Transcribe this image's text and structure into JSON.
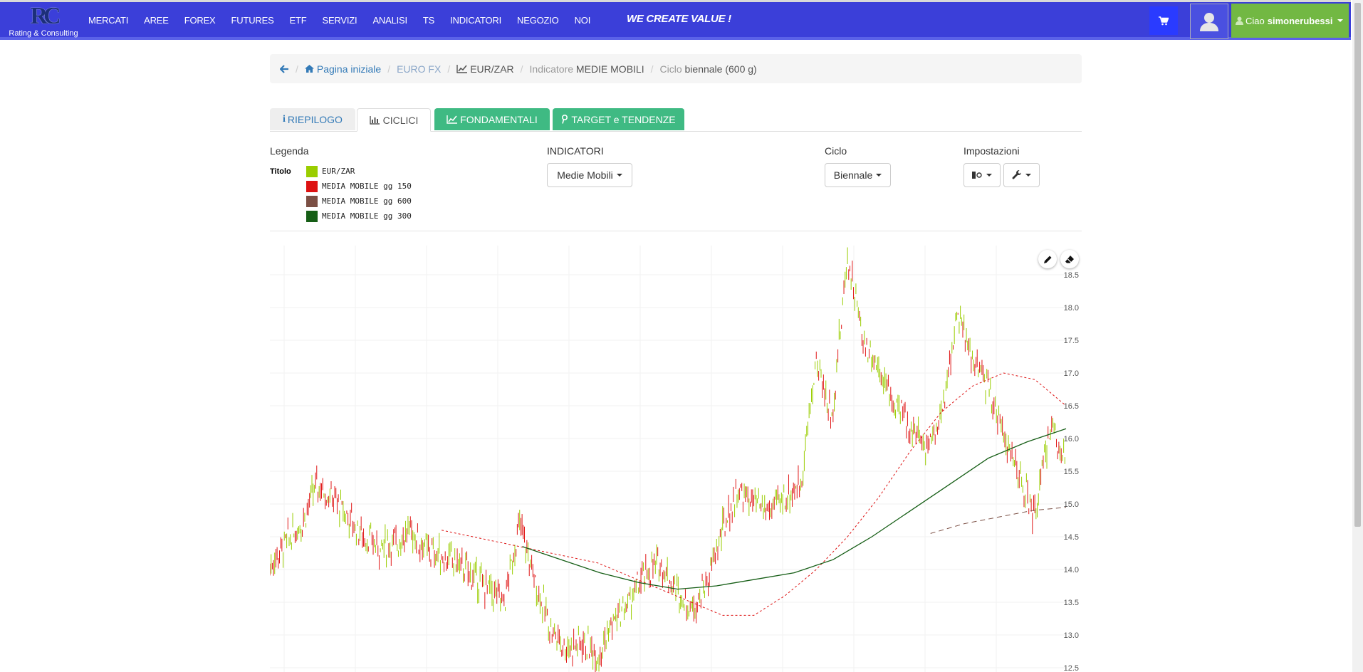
{
  "header": {
    "logo_caption": "Rating & Consulting",
    "nav": [
      "MERCATI",
      "AREE",
      "FOREX",
      "FUTURES",
      "ETF",
      "SERVIZI",
      "ANALISI",
      "TS",
      "INDICATORI",
      "NEGOZIO",
      "NOI"
    ],
    "slogan": "WE CREATE VALUE !",
    "greeting": "Ciao",
    "username": "simonerubessi"
  },
  "breadcrumb": {
    "home": "Pagina iniziale",
    "market": "EURO FX",
    "instrument": "EUR/ZAR",
    "indicator_prefix": "Indicatore",
    "indicator": "MEDIE MOBILI",
    "cycle_prefix": "Ciclo",
    "cycle": "biennale (600 g)"
  },
  "tabs": [
    "RIEPILOGO",
    "CICLICI",
    "FONDAMENTALI",
    "TARGET e TENDENZE"
  ],
  "controls": {
    "legend_header": "Legenda",
    "legend_title_label": "Titolo",
    "indicators_header": "INDICATORI",
    "indicators_value": "Medie Mobili",
    "cycle_header": "Ciclo",
    "cycle_value": "Biennale",
    "settings_header": "Impostazioni"
  },
  "legend": [
    {
      "label": "EUR/ZAR",
      "color": "#9acd00"
    },
    {
      "label": "MEDIA MOBILE gg 150",
      "color": "#dd1111"
    },
    {
      "label": "MEDIA MOBILE gg 600",
      "color": "#7b4f44"
    },
    {
      "label": "MEDIA MOBILE gg 300",
      "color": "#165e16"
    }
  ],
  "chart_data": {
    "type": "line",
    "y_ticks": [
      "18.5",
      "18.0",
      "17.5",
      "17.0",
      "16.5",
      "16.0",
      "15.5",
      "15.0",
      "14.5",
      "14.0",
      "13.5",
      "13.0",
      "12.5"
    ],
    "ylim": [
      12.5,
      18.5
    ],
    "grid": true,
    "series": [
      {
        "name": "EUR/ZAR",
        "values": [
          14.05,
          14.4,
          14.7,
          15.3,
          15.1,
          14.8,
          14.5,
          14.35,
          14.4,
          14.6,
          14.3,
          14.2,
          14.1,
          13.9,
          13.7,
          13.5,
          14.7,
          13.8,
          13.1,
          12.8,
          12.9,
          12.7,
          13.2,
          13.5,
          13.9,
          14.1,
          13.7,
          13.4,
          13.8,
          14.6,
          15.2,
          15.0,
          14.9,
          15.1,
          15.3,
          17.2,
          16.3,
          18.8,
          17.5,
          17.1,
          16.5,
          16.2,
          15.9,
          16.3,
          17.9,
          17.2,
          16.8,
          16.1,
          15.4,
          14.8,
          16.2,
          15.7
        ]
      },
      {
        "name": "MEDIA MOBILE gg 150",
        "values": [
          null,
          null,
          null,
          null,
          null,
          14.6,
          14.5,
          14.4,
          14.3,
          14.2,
          14.1,
          13.9,
          13.7,
          13.5,
          13.3,
          13.3,
          13.6,
          14.0,
          14.5,
          15.1,
          15.8,
          16.4,
          16.8,
          17.0,
          16.9,
          16.5
        ]
      },
      {
        "name": "MEDIA MOBILE gg 600",
        "values": [
          null,
          null,
          null,
          null,
          null,
          null,
          null,
          null,
          null,
          null,
          null,
          null,
          null,
          null,
          null,
          null,
          null,
          null,
          null,
          14.55,
          14.7,
          14.8,
          14.9,
          14.95
        ]
      },
      {
        "name": "MEDIA MOBILE gg 300",
        "values": [
          null,
          null,
          null,
          null,
          null,
          null,
          14.35,
          14.15,
          13.95,
          13.8,
          13.7,
          13.75,
          13.85,
          13.95,
          14.15,
          14.5,
          14.9,
          15.3,
          15.7,
          15.95,
          16.15
        ]
      }
    ]
  },
  "colors": {
    "topbar": "#3b3fd9",
    "tab_green": "#3fba83",
    "greet_green": "#72b843"
  }
}
